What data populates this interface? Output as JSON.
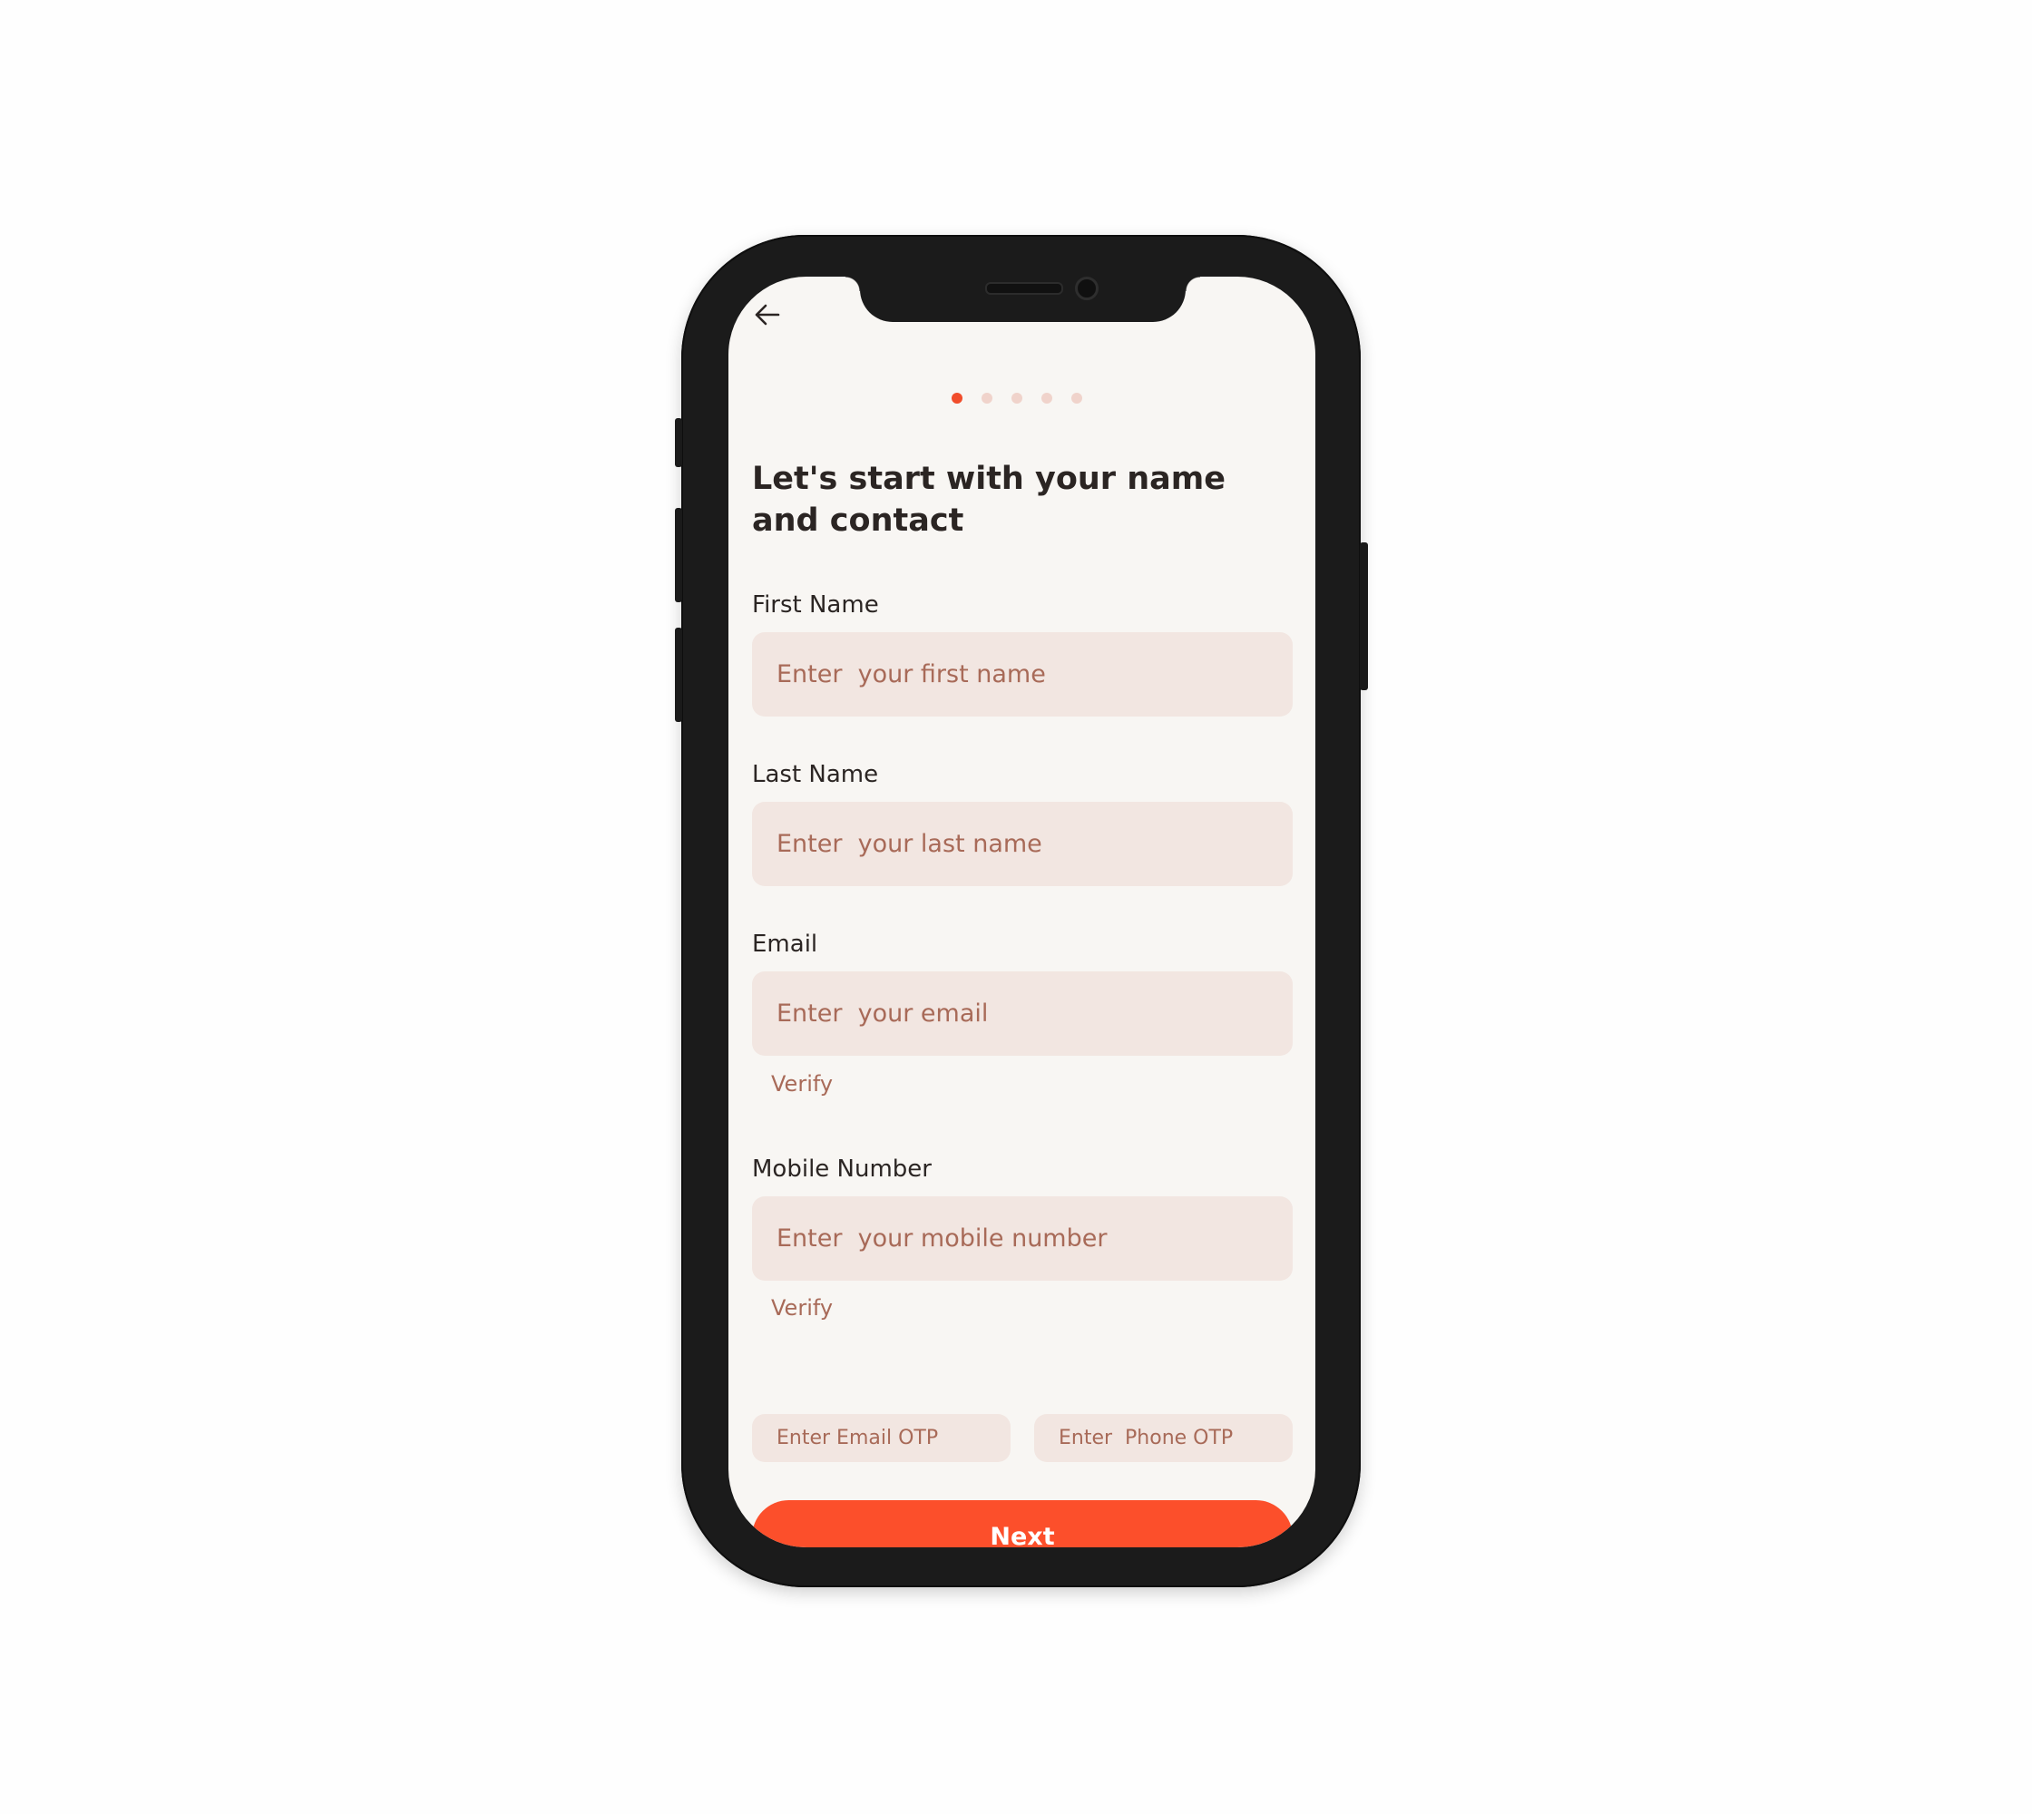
{
  "header": {
    "back_icon": "arrow-left-icon"
  },
  "progress": {
    "total_steps": 5,
    "current_step": 1,
    "active_color": "#f14d2b",
    "inactive_color": "#f0d3cb"
  },
  "form": {
    "title": "Let's start with your name and contact",
    "first_name": {
      "label": "First Name",
      "placeholder": "Enter  your first name"
    },
    "last_name": {
      "label": "Last Name",
      "placeholder": "Enter  your last name"
    },
    "email": {
      "label": "Email",
      "placeholder": "Enter  your email",
      "verify_label": "Verify"
    },
    "mobile": {
      "label": "Mobile Number",
      "placeholder": "Enter  your mobile number",
      "verify_label": "Verify"
    },
    "email_otp": {
      "placeholder": "Enter Email OTP"
    },
    "phone_otp": {
      "placeholder": "Enter  Phone OTP"
    }
  },
  "actions": {
    "next_label": "Next"
  },
  "colors": {
    "accent": "#fc4f2b",
    "input_background": "#f2e6e1",
    "placeholder": "#a86a58",
    "screen_background": "#f8f6f3",
    "text": "#2b2523",
    "phone_frame": "#1b1b1b"
  }
}
